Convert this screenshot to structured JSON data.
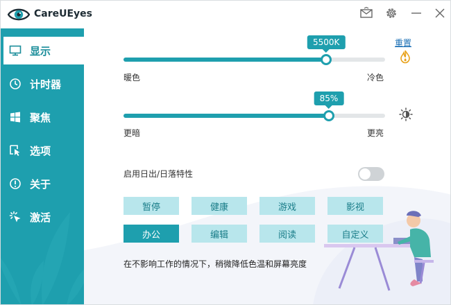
{
  "app": {
    "title": "CareUEyes",
    "accent_color": "#1e9fae",
    "sidebar_color": "#1e9fae"
  },
  "titlebar": {
    "buttons": [
      {
        "icon": "mail-icon"
      },
      {
        "icon": "gear-icon"
      },
      {
        "icon": "minimize-icon"
      },
      {
        "icon": "close-icon"
      }
    ]
  },
  "sidebar": {
    "items": [
      {
        "label": "显示",
        "icon": "monitor-icon",
        "active": true
      },
      {
        "label": "计时器",
        "icon": "clock-icon",
        "active": false
      },
      {
        "label": "聚焦",
        "icon": "windows-icon",
        "active": false
      },
      {
        "label": "选项",
        "icon": "cursor-icon",
        "active": false
      },
      {
        "label": "关于",
        "icon": "info-icon",
        "active": false
      },
      {
        "label": "激活",
        "icon": "sparkle-icon",
        "active": false
      }
    ]
  },
  "main": {
    "reset_label": "重置",
    "temperature": {
      "value_label": "5500K",
      "level": 0.775,
      "left_label": "暖色",
      "right_label": "冷色",
      "icon": "flame-icon"
    },
    "brightness": {
      "value_label": "85%",
      "level": 0.785,
      "left_label": "更暗",
      "right_label": "更亮",
      "icon": "sun-icon"
    },
    "sunrise_sunset": {
      "label": "启用日出/日落特性",
      "enabled": false
    },
    "modes": [
      {
        "label": "暂停",
        "active": false
      },
      {
        "label": "健康",
        "active": false
      },
      {
        "label": "游戏",
        "active": false
      },
      {
        "label": "影视",
        "active": false
      },
      {
        "label": "办公",
        "active": true
      },
      {
        "label": "编辑",
        "active": false
      },
      {
        "label": "阅读",
        "active": false
      },
      {
        "label": "自定义",
        "active": false
      }
    ],
    "description": "在不影响工作的情况下，稍微降低色温和屏幕亮度"
  }
}
